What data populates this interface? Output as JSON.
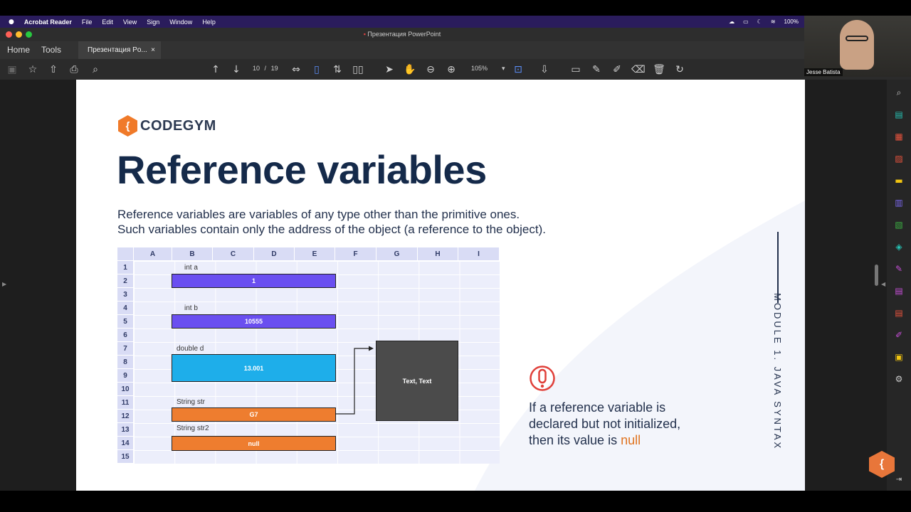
{
  "menubar": {
    "apple": "",
    "app": "Acrobat Reader",
    "items": [
      "File",
      "Edit",
      "View",
      "Sign",
      "Window",
      "Help"
    ],
    "battery": "100%"
  },
  "window": {
    "title": "Презентация PowerPoint"
  },
  "tabs": {
    "home": "Home",
    "tools": "Tools",
    "doc_tab": "Презентация Po...",
    "close": "×"
  },
  "toolbar": {
    "page_current": "10",
    "page_sep": "/",
    "page_total": "19",
    "zoom": "105%"
  },
  "webcam": {
    "name": "Jesse Batista"
  },
  "slide": {
    "logo_text": "CODEGYM",
    "logo_mark": "{",
    "title": "Reference variables",
    "desc_line1": "Reference variables are variables of any type other than the primitive ones.",
    "desc_line2": "Such variables contain only the address of the object (a reference to the object).",
    "grid": {
      "columns": [
        "A",
        "B",
        "C",
        "D",
        "E",
        "F",
        "G",
        "H",
        "I"
      ],
      "rows": [
        "1",
        "2",
        "3",
        "4",
        "5",
        "6",
        "7",
        "8",
        "9",
        "10",
        "11",
        "12",
        "13",
        "14",
        "15"
      ],
      "labels": {
        "r1": "int a",
        "r4": "int b",
        "r7": "double d",
        "r11": "String str",
        "r13": "String str2"
      },
      "values": {
        "a": "1",
        "b": "10555",
        "d": "13.001",
        "str": "G7",
        "str2": "null"
      },
      "object": "Text, Text"
    },
    "vertical_text": "MODULE 1. JAVA SYNTAX",
    "note_prefix": "If a reference variable is declared but not initialized, then its value is",
    "note_null": "null",
    "colors": {
      "int": "#6a4ff0",
      "double": "#1eaeea",
      "string": "#ee7d2f",
      "title": "#152a4a"
    }
  }
}
